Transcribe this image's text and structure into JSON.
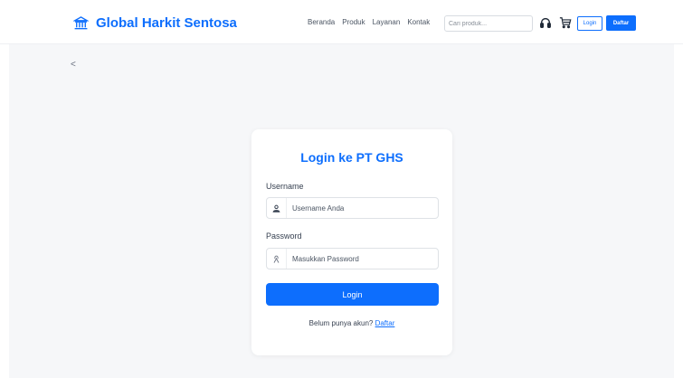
{
  "brand": {
    "name": "Global Harkit Sentosa",
    "icon": "bank-icon"
  },
  "nav": {
    "links": [
      "Beranda",
      "Produk",
      "Layanan",
      "Kontak"
    ],
    "search_placeholder": "Cari produk...",
    "icons": [
      "headset-icon",
      "cart-icon"
    ],
    "login_label": "Login",
    "register_label": "Daftar"
  },
  "back": {
    "label": "<"
  },
  "login_card": {
    "title": "Login ke PT GHS",
    "username_label": "Username",
    "username_placeholder": "Username Anda",
    "password_label": "Password",
    "password_placeholder": "Masukkan Password",
    "submit_label": "Login",
    "register_prompt": "Belum punya akun?",
    "register_link": "Daftar"
  },
  "colors": {
    "primary": "#0d6efd",
    "background": "#f6f7f9"
  }
}
